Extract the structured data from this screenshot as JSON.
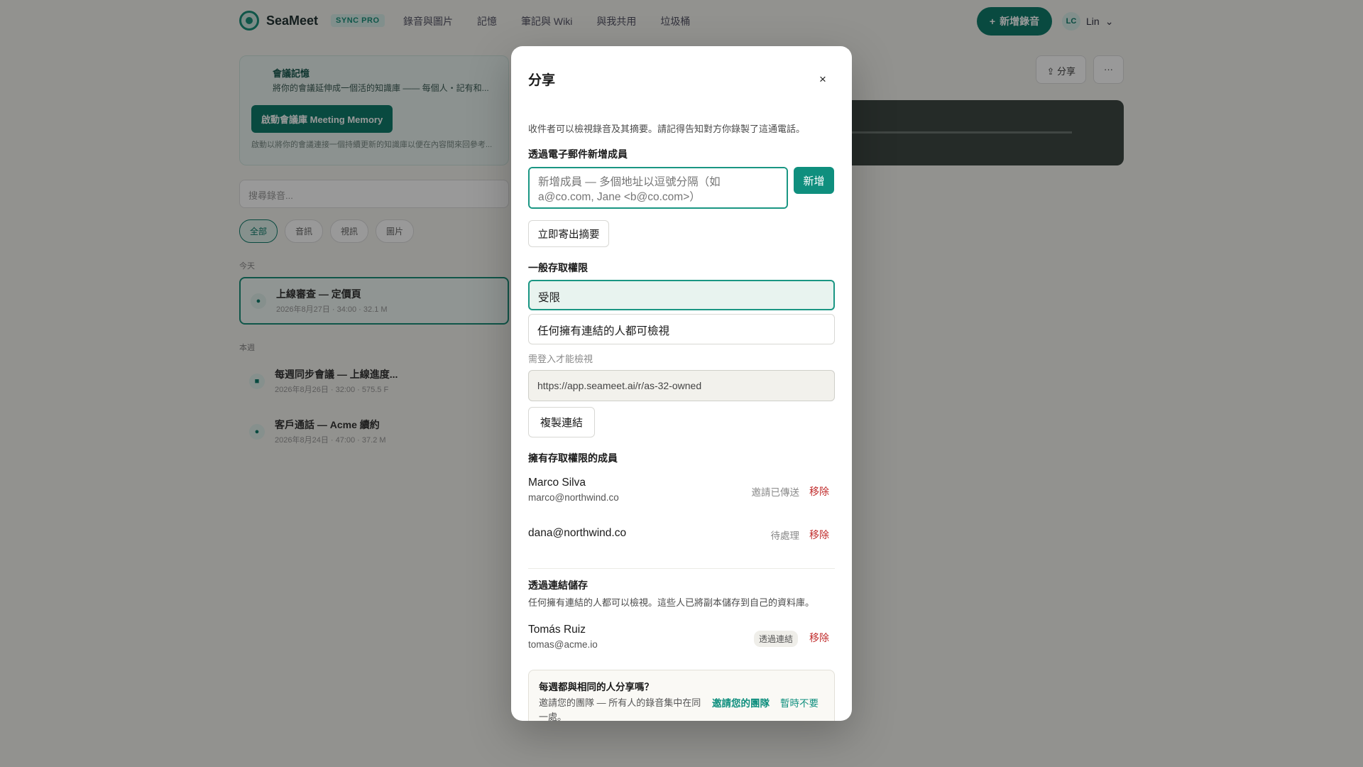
{
  "app": {
    "brand": "SeaMeet",
    "plan_badge": "SYNC PRO",
    "nav": [
      "錄音與圖片",
      "記憶",
      "筆記與 Wiki",
      "與我共用",
      "垃圾桶"
    ],
    "new_recording_label": "新增錄音",
    "user_initials": "LC",
    "user_name": "Lin"
  },
  "background": {
    "memory_title": "會議記憶",
    "memory_desc": "將你的會議延伸成一個活的知識庫 —— 每個人・記有和...",
    "memory_button": "啟動會議庫 Meeting Memory",
    "memory_note": "啟動以將你的會議連接一個持續更新的知識庫以便在內容間來回參考...",
    "search_placeholder": "搜尋錄音...",
    "filters": [
      "全部",
      "音訊",
      "視訊",
      "圖片"
    ],
    "groups": [
      {
        "label": "今天",
        "items": [
          {
            "title": "上線審查 — 定價頁",
            "meta": "2026年8月27日 · 34:00 · 32.1 M"
          }
        ]
      },
      {
        "label": "本週",
        "items": [
          {
            "title": "每週同步會議 — 上線進度...",
            "meta": "2026年8月26日 · 32:00 · 575.5 F"
          },
          {
            "title": "客戶通話 — Acme 續約",
            "meta": "2026年8月24日 · 47:00 · 37.2 M"
          }
        ]
      }
    ],
    "share_button": "分享",
    "more_button": "···"
  },
  "dialog": {
    "title": "分享",
    "close_label": "×",
    "intro": "收件者可以檢視錄音及其摘要。請記得告知對方你錄製了這通電話。",
    "add_by_email_label": "透過電子郵件新增成員",
    "email_placeholder": "新增成員 — 多個地址以逗號分隔（如 a@co.com, Jane <b@co.com>）",
    "add_button": "新增",
    "send_summary_button": "立即寄出摘要",
    "general_access_label": "一般存取權限",
    "access_options": [
      "受限",
      "任何擁有連結的人都可檢視"
    ],
    "selected_access": "受限",
    "access_hint": "需登入才能檢視",
    "share_link": "https://app.seameet.ai/r/as-32-owned",
    "copy_link_button": "複製連結",
    "members_label": "擁有存取權限的成員",
    "members": [
      {
        "name": "Marco Silva",
        "email": "marco@northwind.co",
        "status": "邀請已傳送",
        "remove": "移除"
      },
      {
        "name": "",
        "email": "dana@northwind.co",
        "status": "待處理",
        "remove": "移除"
      }
    ],
    "via_link_label": "透過連結儲存",
    "via_link_desc": "任何擁有連結的人都可以檢視。這些人已將副本儲存到自己的資料庫。",
    "via_link_members": [
      {
        "name": "Tomás Ruiz",
        "email": "tomas@acme.io",
        "badge": "透過連結",
        "remove": "移除"
      }
    ],
    "promo": {
      "title": "每週都與相同的人分享嗎？",
      "body": "邀請您的團隊 — 所有人的錄音集中在同一處。",
      "invite": "邀請您的團隊",
      "dismiss": "暫時不要"
    }
  },
  "colors": {
    "accent": "#0f8f7e",
    "danger": "#c02b2b",
    "selected_bg": "#e8f3ef"
  }
}
